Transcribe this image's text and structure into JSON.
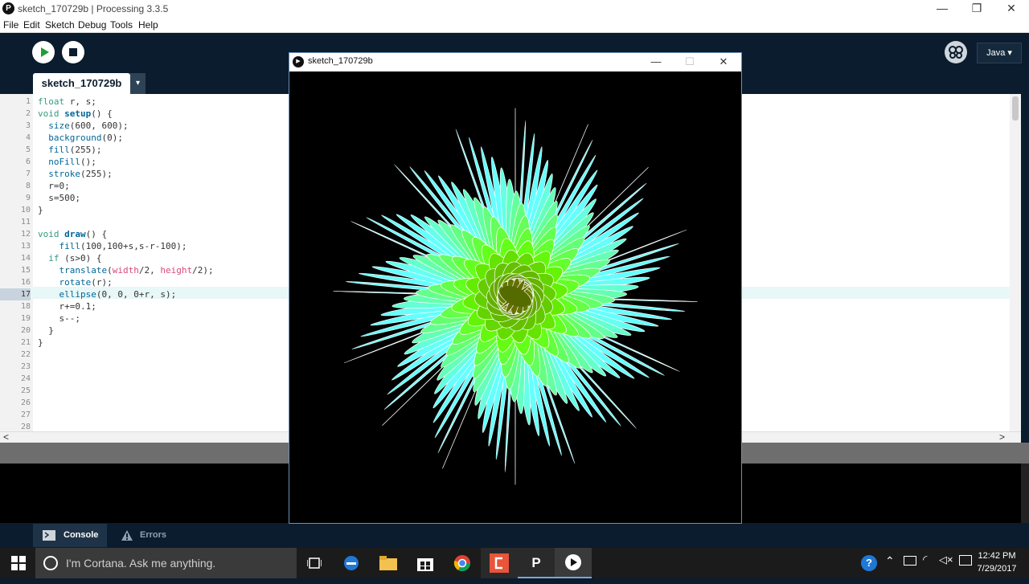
{
  "window": {
    "title": "sketch_170729b | Processing 3.3.5",
    "app_icon_glyph": "P",
    "min_glyph": "—",
    "restore_glyph": "❐",
    "close_glyph": "✕"
  },
  "menu": [
    "File",
    "Edit",
    "Sketch",
    "Debug",
    "Tools",
    "Help"
  ],
  "toolbar": {
    "run_icon": "play-icon",
    "stop_icon": "stop-icon",
    "mode_label": "Java ▾"
  },
  "tab": {
    "label": "sketch_170729b",
    "menu_glyph": "▾"
  },
  "editor": {
    "active_line": 17,
    "lines": [
      "float r, s;",
      "void setup() {",
      "  size(600, 600);",
      "  background(0);",
      "  fill(255);",
      "  noFill();",
      "  stroke(255);",
      "  r=0;",
      "  s=500;",
      "}",
      "",
      "void draw() {",
      "    fill(100,100+s,s-r-100);",
      "  if (s>0) {",
      "    translate(width/2, height/2);",
      "    rotate(r);",
      "    ellipse(0, 0, 0+r, s);",
      "    r+=0.1;",
      "    s--;",
      "  }",
      "}",
      "",
      "",
      "",
      "",
      "",
      "",
      ""
    ],
    "scroll_left": "<",
    "scroll_right": ">"
  },
  "footer": {
    "console_label": "Console",
    "errors_label": "Errors"
  },
  "sketch_window": {
    "title": "sketch_170729b",
    "icon_glyph": "▶",
    "min_glyph": "—",
    "max_glyph": "☐",
    "close_glyph": "✕"
  },
  "taskbar": {
    "search_placeholder": "I'm Cortana. Ask me anything.",
    "time": "12:42 PM",
    "date": "7/29/2017",
    "icons": [
      "windows-start-icon",
      "task-view-icon",
      "edge-icon",
      "file-explorer-icon",
      "store-icon",
      "chrome-icon",
      "app-icon",
      "processing-icon",
      "sketch-running-icon"
    ]
  }
}
